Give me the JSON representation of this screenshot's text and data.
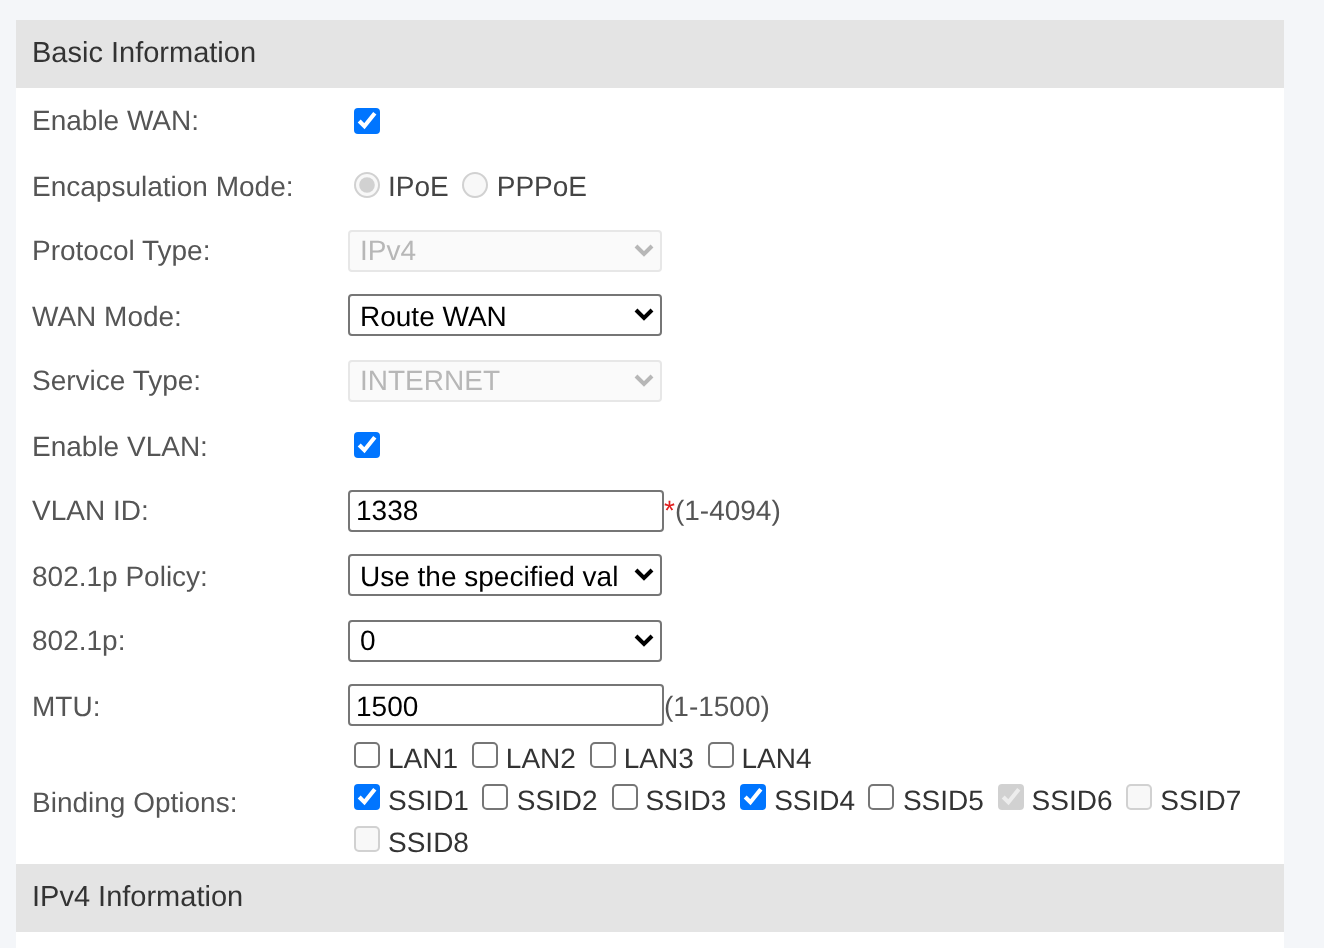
{
  "section": {
    "title": "Basic Information"
  },
  "fields": [
    {
      "kind": "checkbox",
      "label": "Enable WAN:",
      "checked": true
    },
    {
      "kind": "radio",
      "label": "Encapsulation Mode:",
      "options": [
        {
          "label": "IPoE",
          "selected": true,
          "disabled": true
        },
        {
          "label": "PPPoE",
          "selected": false,
          "disabled": true
        }
      ]
    },
    {
      "kind": "select",
      "label": "Protocol Type:",
      "value": "IPv4",
      "disabled": true
    },
    {
      "kind": "select",
      "label": "WAN Mode:",
      "value": "Route WAN",
      "disabled": false
    },
    {
      "kind": "select",
      "label": "Service Type:",
      "value": "INTERNET",
      "disabled": true
    },
    {
      "kind": "checkbox",
      "label": "Enable VLAN:",
      "checked": true
    },
    {
      "kind": "text",
      "label": "VLAN ID:",
      "value": "1338",
      "required_mark": "*",
      "hint": "(1-4094)"
    },
    {
      "kind": "select",
      "label": "802.1p Policy:",
      "value": "Use the specified val",
      "disabled": false
    },
    {
      "kind": "select",
      "label": "802.1p:",
      "value": "0",
      "disabled": false
    },
    {
      "kind": "text",
      "label": "MTU:",
      "value": "1500",
      "hint": "(1-1500)"
    },
    {
      "kind": "checkgroup",
      "label": "Binding Options:",
      "options": [
        {
          "label": "LAN1",
          "checked": false,
          "disabled": false
        },
        {
          "label": "LAN2",
          "checked": false,
          "disabled": false
        },
        {
          "label": "LAN3",
          "checked": false,
          "disabled": false
        },
        {
          "label": "LAN4",
          "checked": false,
          "disabled": false
        },
        {
          "label": "SSID1",
          "checked": true,
          "disabled": false
        },
        {
          "label": "SSID2",
          "checked": false,
          "disabled": false
        },
        {
          "label": "SSID3",
          "checked": false,
          "disabled": false
        },
        {
          "label": "SSID4",
          "checked": true,
          "disabled": false
        },
        {
          "label": "SSID5",
          "checked": false,
          "disabled": false
        },
        {
          "label": "SSID6",
          "checked": true,
          "disabled": true
        },
        {
          "label": "SSID7",
          "checked": false,
          "disabled": true
        },
        {
          "label": "SSID8",
          "checked": false,
          "disabled": true
        }
      ]
    }
  ],
  "next_section": {
    "title": "IPv4 Information"
  }
}
